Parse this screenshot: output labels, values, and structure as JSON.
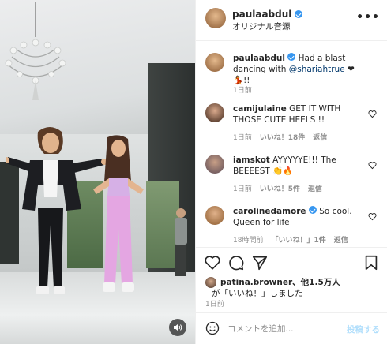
{
  "header": {
    "username": "paulaabdul",
    "audio_label": "オリジナル音源",
    "more_icon": "more-horizontal-icon"
  },
  "caption": {
    "username": "paulaabdul",
    "text_before": "Had a blast dancing with",
    "mention": "@shariahtrue",
    "text_after": "❤💃!!",
    "time": "1日前"
  },
  "comments": [
    {
      "username": "camijulaine",
      "text": "GET IT WITH THOSE CUTE HEELS !!",
      "time": "1日前",
      "likes": "いいね！18件",
      "reply": "返信"
    },
    {
      "username": "iamskot",
      "text": "AYYYYYE!!! The BEEEEST 👏🔥",
      "time": "1日前",
      "likes": "いいね！5件",
      "reply": "返信"
    },
    {
      "username": "carolinedamore",
      "text": "So cool. Queen for life",
      "time": "18時間前",
      "likes": "「いいね！」1件",
      "reply": "返信"
    }
  ],
  "actions": {
    "like_icon": "heart-icon",
    "comment_icon": "comment-icon",
    "share_icon": "send-icon",
    "save_icon": "bookmark-icon"
  },
  "likes": {
    "line1": "patina.browner、他1.5万人",
    "line2": "が「いいね！」しました"
  },
  "post_time": "1日前",
  "add_comment": {
    "placeholder": "コメントを追加...",
    "post_label": "投稿する"
  },
  "colors": {
    "verified": "#3897f0",
    "link": "#00376b",
    "post_disabled": "#b2dffc",
    "muted": "#8e8e8e"
  }
}
